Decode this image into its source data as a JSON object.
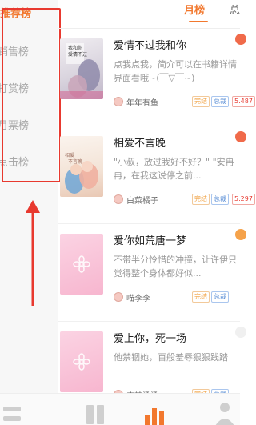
{
  "sidebar": {
    "items": [
      {
        "label": "推荐榜",
        "active": true
      },
      {
        "label": "销售榜",
        "active": false
      },
      {
        "label": "打赏榜",
        "active": false
      },
      {
        "label": "月票榜",
        "active": false
      },
      {
        "label": "点击榜",
        "active": false
      }
    ]
  },
  "tabs": {
    "items": [
      {
        "label": "月榜",
        "active": true
      },
      {
        "label": "总",
        "active": false
      }
    ]
  },
  "books": [
    {
      "title": "爱情不过我和你",
      "desc": "点我点我，简介可以在书籍详情界面看哦~(￣▽￣~)",
      "author": "年年有鱼",
      "status": "完结",
      "genre": "总裁",
      "count": "5.487",
      "cover_text": "我和你爱情不过"
    },
    {
      "title": "相爱不言晚",
      "desc": "\"小叔，放过我好不好？\" \"安冉冉，在我这说停之前...",
      "author": "白菜橘子",
      "status": "完结",
      "genre": "总裁",
      "count": "5.297",
      "cover_text": "相爱不言晚"
    },
    {
      "title": "爱你如荒唐一梦",
      "desc": "不带半分怜惜的冲撞，让许伊只觉得整个身体都好似...",
      "author": "喵李李",
      "status": "完结",
      "genre": "总裁",
      "count": "",
      "cover_text": ""
    },
    {
      "title": "爱上你，死一场",
      "desc": "他禁锢她，百般羞辱狠狠践踏",
      "author": "麻辣烫烫",
      "status": "完结",
      "genre": "总裁",
      "count": "",
      "cover_text": ""
    }
  ],
  "colors": {
    "accent": "#f2782e",
    "annotation_red": "#e8392f",
    "rank_dots": [
      "#f06a4a",
      "#f06a4a",
      "#f5a24a",
      "#f0f0f0"
    ]
  },
  "bottom_nav": {
    "icons": [
      "bookshelf-icon",
      "store-icon",
      "rank-icon",
      "profile-icon"
    ]
  }
}
